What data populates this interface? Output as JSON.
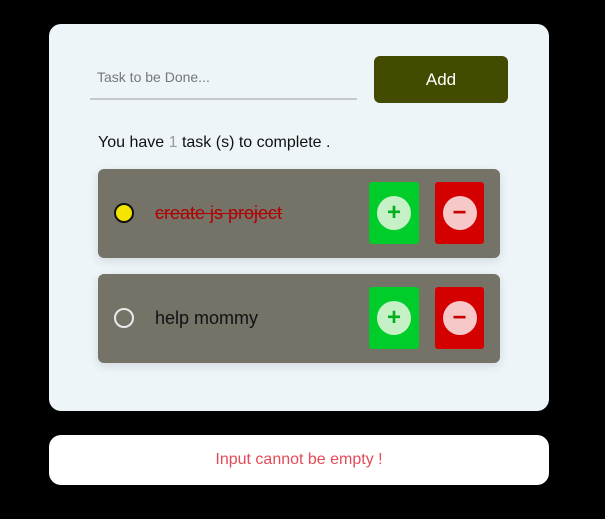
{
  "form": {
    "input_placeholder": "Task to be Done...",
    "input_value": "",
    "add_label": "Add"
  },
  "summary": {
    "prefix": "You have",
    "count": "1",
    "suffix": "task (s) to complete ."
  },
  "tasks": [
    {
      "label": "create js project",
      "completed": true,
      "plus": "+",
      "minus": "−"
    },
    {
      "label": "help mommy",
      "completed": false,
      "plus": "+",
      "minus": "−"
    }
  ],
  "notice": {
    "text": "Input cannot be empty !"
  },
  "colors": {
    "page_bg": "#000000",
    "card_bg": "#eef5f9",
    "add_button": "#434b00",
    "task_bg": "#757268",
    "plus_green": "#00cc2a",
    "minus_red": "#d40000",
    "checked_radio": "#f5e400",
    "done_text": "#b00000",
    "notice_text": "#e24b57"
  },
  "icons": {
    "plus": "plus-circle-icon",
    "minus": "minus-circle-icon"
  }
}
